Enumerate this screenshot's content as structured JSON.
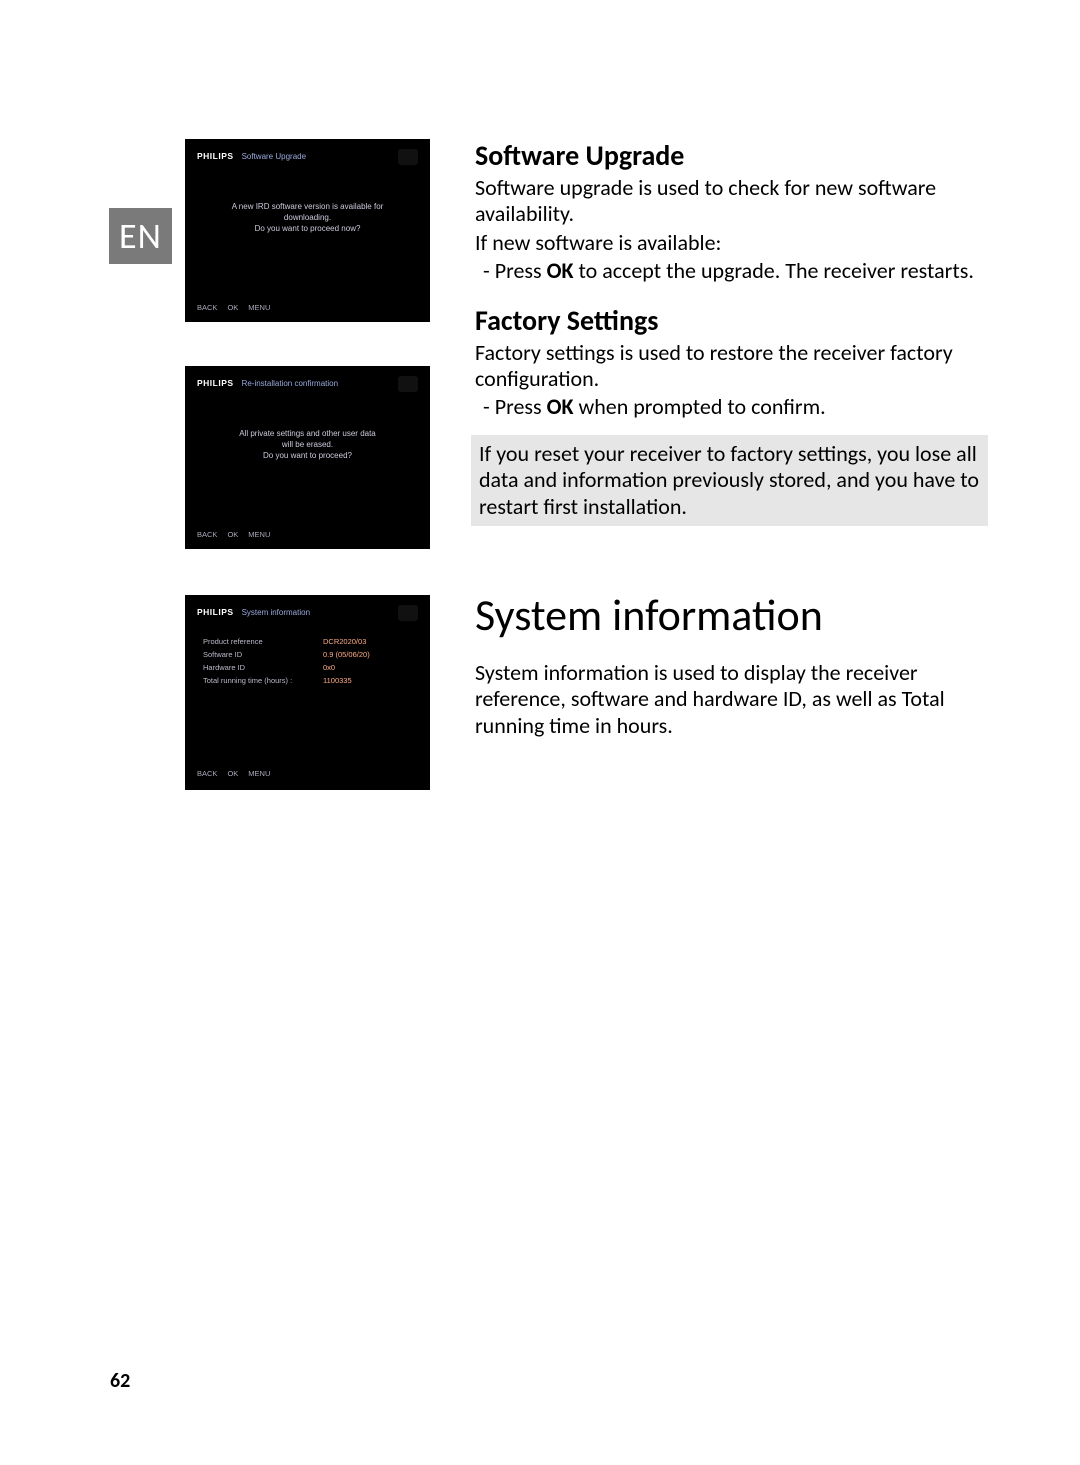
{
  "lang_tab": "EN",
  "page_number": "62",
  "screenshots": {
    "brand": "PHILIPS",
    "footer_back": "BACK",
    "footer_ok": "OK",
    "footer_menu": "MENU",
    "sc1": {
      "title": "Software Upgrade",
      "line1": "A new IRD software version is available for",
      "line2": "downloading.",
      "line3": "Do you want to proceed now?"
    },
    "sc2": {
      "title": "Re-installation confirmation",
      "line1": "All private settings and other user data",
      "line2": "will be erased.",
      "line3": "Do you want to proceed?"
    },
    "sc3": {
      "title": "System information",
      "rows": [
        {
          "label": "Product reference",
          "value": "DCR2020/03"
        },
        {
          "label": "Software ID",
          "value": "0.9 (05/06/20)"
        },
        {
          "label": "Hardware ID",
          "value": "0x0"
        },
        {
          "label": "Total running time (hours) :",
          "value": "1100335"
        }
      ]
    }
  },
  "section1": {
    "heading": "Software Upgrade",
    "p1": "Software upgrade is used to check for new software availability.",
    "p2": "If new software is available:",
    "bullet_pre": "Press ",
    "bullet_bold": "OK",
    "bullet_post": " to accept the upgrade. The receiver restarts."
  },
  "section2": {
    "heading": "Factory Settings",
    "p1": "Factory settings is used to restore the receiver factory configuration.",
    "bullet_pre": "Press ",
    "bullet_bold": "OK",
    "bullet_post": " when prompted to confirm.",
    "callout": "If you reset your receiver to factory settings, you lose all data and information previously stored, and you have to restart first installation."
  },
  "section3": {
    "heading": "System information",
    "p1": "System information is used to display the receiver reference, software and hardware ID, as well as Total running time in hours."
  }
}
